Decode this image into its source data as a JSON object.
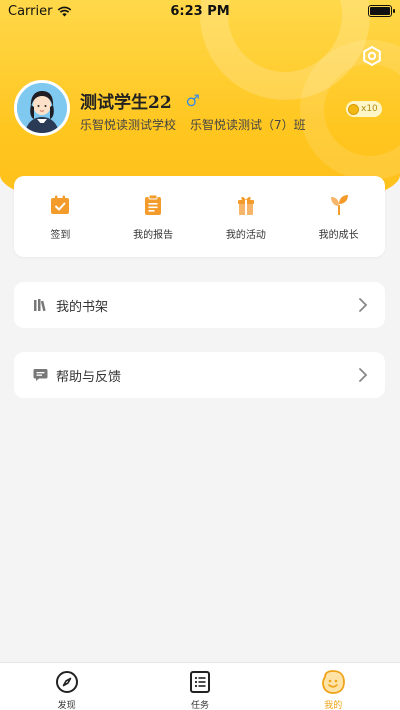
{
  "status_bar": {
    "carrier": "Carrier",
    "time": "6:23 PM"
  },
  "profile": {
    "name": "测试学生22",
    "gender_symbol": "♂",
    "school": "乐智悦读测试学校",
    "class": "乐智悦读测试（7）班",
    "coins": "x10"
  },
  "actions": [
    {
      "label": "签到",
      "icon": "calendar-check-icon"
    },
    {
      "label": "我的报告",
      "icon": "report-icon"
    },
    {
      "label": "我的活动",
      "icon": "gift-icon"
    },
    {
      "label": "我的成长",
      "icon": "sprout-icon"
    }
  ],
  "menu": [
    {
      "label": "我的书架",
      "icon": "bookshelf-icon"
    },
    {
      "label": "帮助与反馈",
      "icon": "chat-bubble-icon"
    }
  ],
  "tabs": [
    {
      "label": "发现",
      "icon": "compass-icon",
      "active": false
    },
    {
      "label": "任务",
      "icon": "task-list-icon",
      "active": false
    },
    {
      "label": "我的",
      "icon": "smiley-icon",
      "active": true
    }
  ],
  "colors": {
    "accent": "#ffc61f",
    "active_tab": "#f0a318",
    "icon_orange": "#f39c2b"
  }
}
